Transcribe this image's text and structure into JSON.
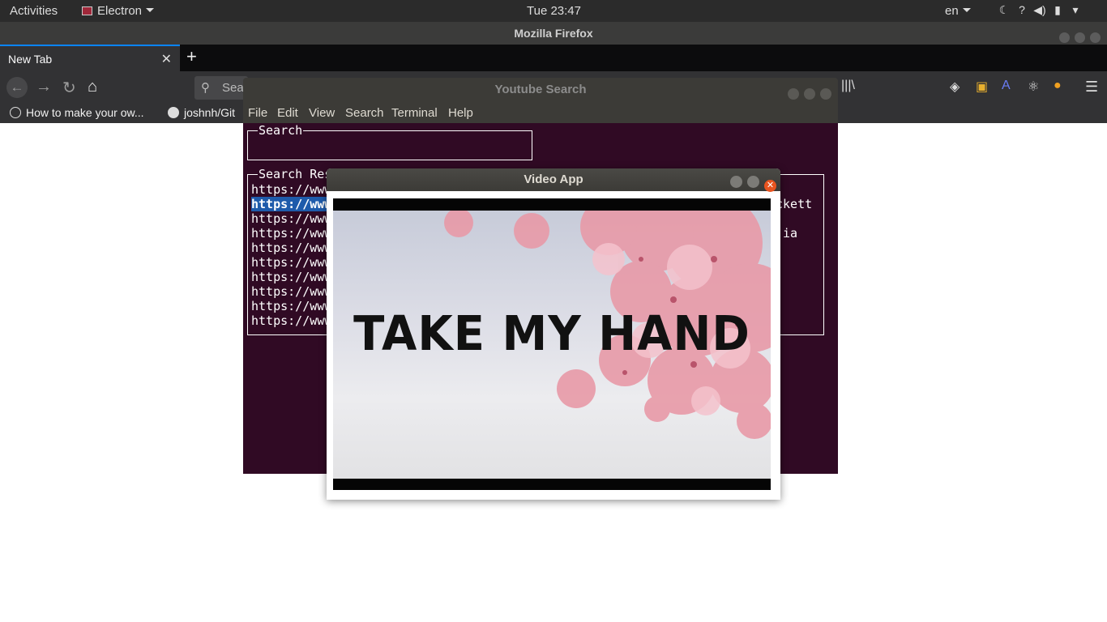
{
  "topbar": {
    "activities": "Activities",
    "app_menu": "Electron",
    "clock": "Tue 23:47",
    "language": "en",
    "tray_icons": [
      "night-light-icon",
      "help-icon",
      "volume-icon",
      "battery-icon",
      "system-menu-arrow-icon"
    ]
  },
  "firefox": {
    "window_title": "Mozilla Firefox",
    "tab_label": "New Tab",
    "search_placeholder": "Sear",
    "bookmarks": [
      {
        "label": "How to make your ow...",
        "icon": "globe-icon"
      },
      {
        "label": "joshnh/Git",
        "icon": "github-icon"
      }
    ]
  },
  "terminal": {
    "title": "Youtube Search",
    "menu": [
      "File",
      "Edit",
      "View",
      "Search",
      "Terminal",
      "Help"
    ],
    "search_box_label": "Search",
    "results_box_label": "Search Res",
    "results": [
      "https://www",
      "https://www",
      "https://www",
      "https://www",
      "https://www",
      "https://www",
      "https://www",
      "https://www",
      "https://www",
      "https://www"
    ],
    "selected_index": 1,
    "right_fragments": [
      {
        "row": 1,
        "text": "ckett"
      },
      {
        "row": 3,
        "text": "jia"
      }
    ]
  },
  "video_app": {
    "title": "Video App",
    "frame_text": "TAKE MY HAND"
  },
  "colors": {
    "terminal_bg": "#300a24",
    "selection": "#1e5bab",
    "close_button": "#e9541f",
    "firefox_accent": "#0a84ff"
  }
}
